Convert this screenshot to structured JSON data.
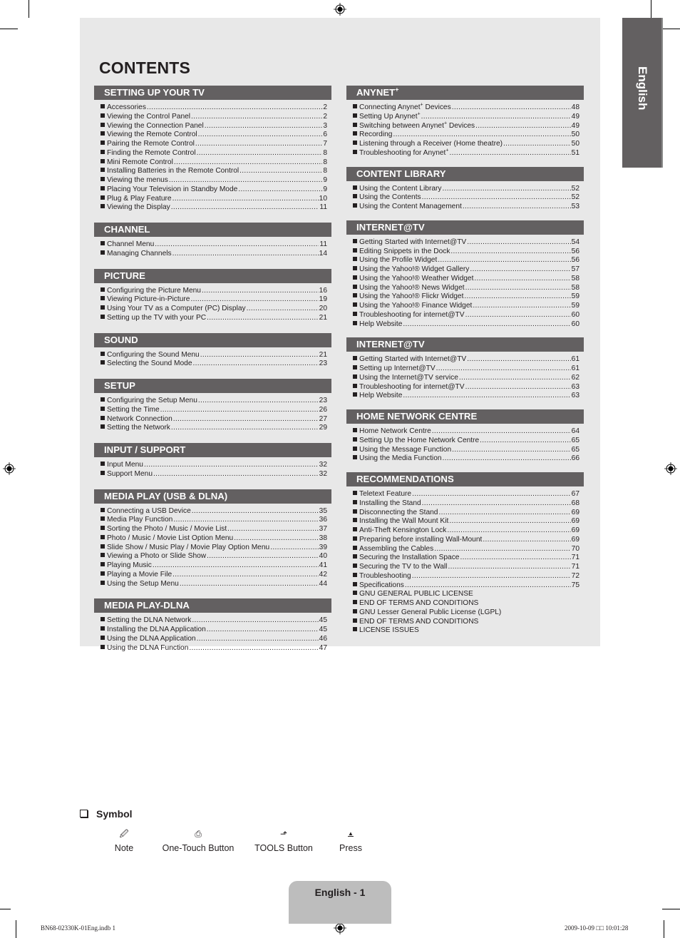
{
  "title": "CONTENTS",
  "side_tab": "English",
  "left_sections": [
    {
      "heading": "SETTING UP YOUR TV",
      "items": [
        {
          "label": "Accessories",
          "page": "2"
        },
        {
          "label": "Viewing the Control Panel",
          "page": "2"
        },
        {
          "label": "Viewing the Connection Panel",
          "page": "3"
        },
        {
          "label": "Viewing the Remote Control",
          "page": "6"
        },
        {
          "label": "Pairing the Remote Control",
          "page": "7"
        },
        {
          "label": "Finding the Remote Control",
          "page": "8"
        },
        {
          "label": "Mini Remote Control",
          "page": "8"
        },
        {
          "label": "Installing Batteries in the Remote Control",
          "page": "8"
        },
        {
          "label": "Viewing the menus",
          "page": "9"
        },
        {
          "label": "Placing Your Television in Standby Mode",
          "page": "9"
        },
        {
          "label": "Plug & Play Feature",
          "page": "10"
        },
        {
          "label": "Viewing the Display",
          "page": "11"
        }
      ]
    },
    {
      "heading": "CHANNEL",
      "items": [
        {
          "label": "Channel Menu",
          "page": "11"
        },
        {
          "label": "Managing Channels",
          "page": "14"
        }
      ]
    },
    {
      "heading": "PICTURE",
      "items": [
        {
          "label": "Configuring the Picture Menu",
          "page": "16"
        },
        {
          "label": "Viewing Picture-in-Picture",
          "page": "19"
        },
        {
          "label": "Using Your TV as a Computer (PC) Display",
          "page": "20"
        },
        {
          "label": "Setting up the TV with your PC",
          "page": "21"
        }
      ]
    },
    {
      "heading": "SOUND",
      "items": [
        {
          "label": "Configuring the Sound Menu",
          "page": "21"
        },
        {
          "label": "Selecting the Sound Mode",
          "page": "23"
        }
      ]
    },
    {
      "heading": "SETUP",
      "items": [
        {
          "label": "Configuring the Setup Menu",
          "page": "23"
        },
        {
          "label": "Setting the Time",
          "page": "26"
        },
        {
          "label": "Network Connection",
          "page": "27"
        },
        {
          "label": "Setting the Network",
          "page": "29"
        }
      ]
    },
    {
      "heading": "INPUT / SUPPORT",
      "items": [
        {
          "label": "Input Menu",
          "page": "32"
        },
        {
          "label": "Support Menu",
          "page": "32"
        }
      ]
    },
    {
      "heading": "MEDIA PLAY (USB & DLNA)",
      "items": [
        {
          "label": "Connecting a USB Device",
          "page": "35"
        },
        {
          "label": "Media Play Function",
          "page": "36"
        },
        {
          "label": "Sorting the Photo / Music / Movie List",
          "page": "37"
        },
        {
          "label": "Photo / Music / Movie List Option Menu",
          "page": "38"
        },
        {
          "label": "Slide Show / Music Play / Movie Play Option Menu",
          "page": "39"
        },
        {
          "label": "Viewing a Photo or Slide Show",
          "page": "40"
        },
        {
          "label": "Playing Music",
          "page": "41"
        },
        {
          "label": "Playing a Movie File",
          "page": "42"
        },
        {
          "label": "Using the Setup Menu",
          "page": "44"
        }
      ]
    },
    {
      "heading": "MEDIA PLAY-DLNA",
      "items": [
        {
          "label": "Setting the DLNA Network",
          "page": "45"
        },
        {
          "label": "Installing the DLNA Application",
          "page": "45"
        },
        {
          "label": "Using the DLNA Application",
          "page": "46"
        },
        {
          "label": "Using the DLNA Function",
          "page": "47"
        }
      ]
    }
  ],
  "right_sections": [
    {
      "heading": "ANYNET",
      "heading_sup": "+",
      "items": [
        {
          "label": "Connecting Anynet",
          "sup": "+",
          "label_after": " Devices",
          "page": "48"
        },
        {
          "label": "Setting Up Anynet",
          "sup": "+",
          "label_after": "",
          "page": "49"
        },
        {
          "label": "Switching between Anynet",
          "sup": "+",
          "label_after": " Devices",
          "page": "49"
        },
        {
          "label": "Recording",
          "page": "50"
        },
        {
          "label": "Listening through a Receiver (Home theatre)",
          "page": "50"
        },
        {
          "label": "Troubleshooting for Anynet",
          "sup": "+",
          "label_after": "",
          "page": "51"
        }
      ]
    },
    {
      "heading": "CONTENT LIBRARY",
      "items": [
        {
          "label": "Using the Content Library",
          "page": "52"
        },
        {
          "label": "Using the Contents",
          "page": "52"
        },
        {
          "label": "Using the Content Management",
          "page": "53"
        }
      ]
    },
    {
      "heading": "INTERNET@TV",
      "items": [
        {
          "label": "Getting Started with Internet@TV",
          "page": "54"
        },
        {
          "label": "Editing Snippets in the Dock",
          "page": "56"
        },
        {
          "label": "Using the Profile Widget",
          "page": "56"
        },
        {
          "label": "Using the Yahoo!® Widget Gallery",
          "page": "57"
        },
        {
          "label": "Using the Yahoo!® Weather Widget",
          "page": "58"
        },
        {
          "label": "Using the Yahoo!® News Widget",
          "page": "58"
        },
        {
          "label": "Using the Yahoo!® Flickr Widget",
          "page": "59"
        },
        {
          "label": "Using the Yahoo!® Finance Widget",
          "page": "59"
        },
        {
          "label": "Troubleshooting for internet@TV",
          "page": "60"
        },
        {
          "label": "Help Website",
          "page": "60"
        }
      ]
    },
    {
      "heading": "INTERNET@TV",
      "items": [
        {
          "label": "Getting Started with Internet@TV",
          "page": "61"
        },
        {
          "label": "Setting up Internet@TV",
          "page": "61"
        },
        {
          "label": "Using the Internet@TV service",
          "page": "62"
        },
        {
          "label": "Troubleshooting for internet@TV",
          "page": "63"
        },
        {
          "label": "Help Website",
          "page": "63"
        }
      ]
    },
    {
      "heading": "HOME NETWORK CENTRE",
      "items": [
        {
          "label": "Home Network Centre",
          "page": "64"
        },
        {
          "label": "Setting Up the Home Network Centre",
          "page": "65"
        },
        {
          "label": "Using the Message Function",
          "page": "65"
        },
        {
          "label": "Using the Media Function",
          "page": "66"
        }
      ]
    },
    {
      "heading": "RECOMMENDATIONS",
      "items": [
        {
          "label": "Teletext Feature",
          "page": "67"
        },
        {
          "label": "Installing the Stand",
          "page": "68"
        },
        {
          "label": "Disconnecting the Stand",
          "page": "69"
        },
        {
          "label": "Installing the Wall Mount Kit",
          "page": "69"
        },
        {
          "label": "Anti-Theft Kensington Lock",
          "page": "69"
        },
        {
          "label": "Preparing before installing Wall-Mount",
          "page": "69"
        },
        {
          "label": "Assembling the Cables",
          "page": "70"
        },
        {
          "label": "Securing the Installation Space",
          "page": "71"
        },
        {
          "label": "Securing the TV to the Wall",
          "page": "71"
        },
        {
          "label": "Troubleshooting",
          "page": "72"
        },
        {
          "label": "Specifications",
          "page": "75"
        },
        {
          "label": "GNU GENERAL PUBLIC LICENSE",
          "page": ""
        },
        {
          "label": "END OF TERMS AND CONDITIONS",
          "page": ""
        },
        {
          "label": "GNU Lesser General Public License (LGPL)",
          "page": ""
        },
        {
          "label": "END OF TERMS AND CONDITIONS",
          "page": ""
        },
        {
          "label": "LICENSE ISSUES",
          "page": ""
        }
      ]
    }
  ],
  "symbol": {
    "heading": "Symbol",
    "items": [
      {
        "icon": "note-icon",
        "glyph": "🖉",
        "label": "Note"
      },
      {
        "icon": "one-touch-button-icon",
        "glyph": "⎙",
        "label": "One-Touch Button"
      },
      {
        "icon": "tools-button-icon",
        "glyph": "⬏",
        "label": "TOOLS Button"
      },
      {
        "icon": "press-icon",
        "glyph": "▲",
        "label": "Press"
      }
    ]
  },
  "footer": {
    "page_label": "English - 1",
    "file_slug": "BN68-02330K-01Eng.indb   1",
    "timestamp": "2009-10-09   □□ 10:01:28"
  }
}
